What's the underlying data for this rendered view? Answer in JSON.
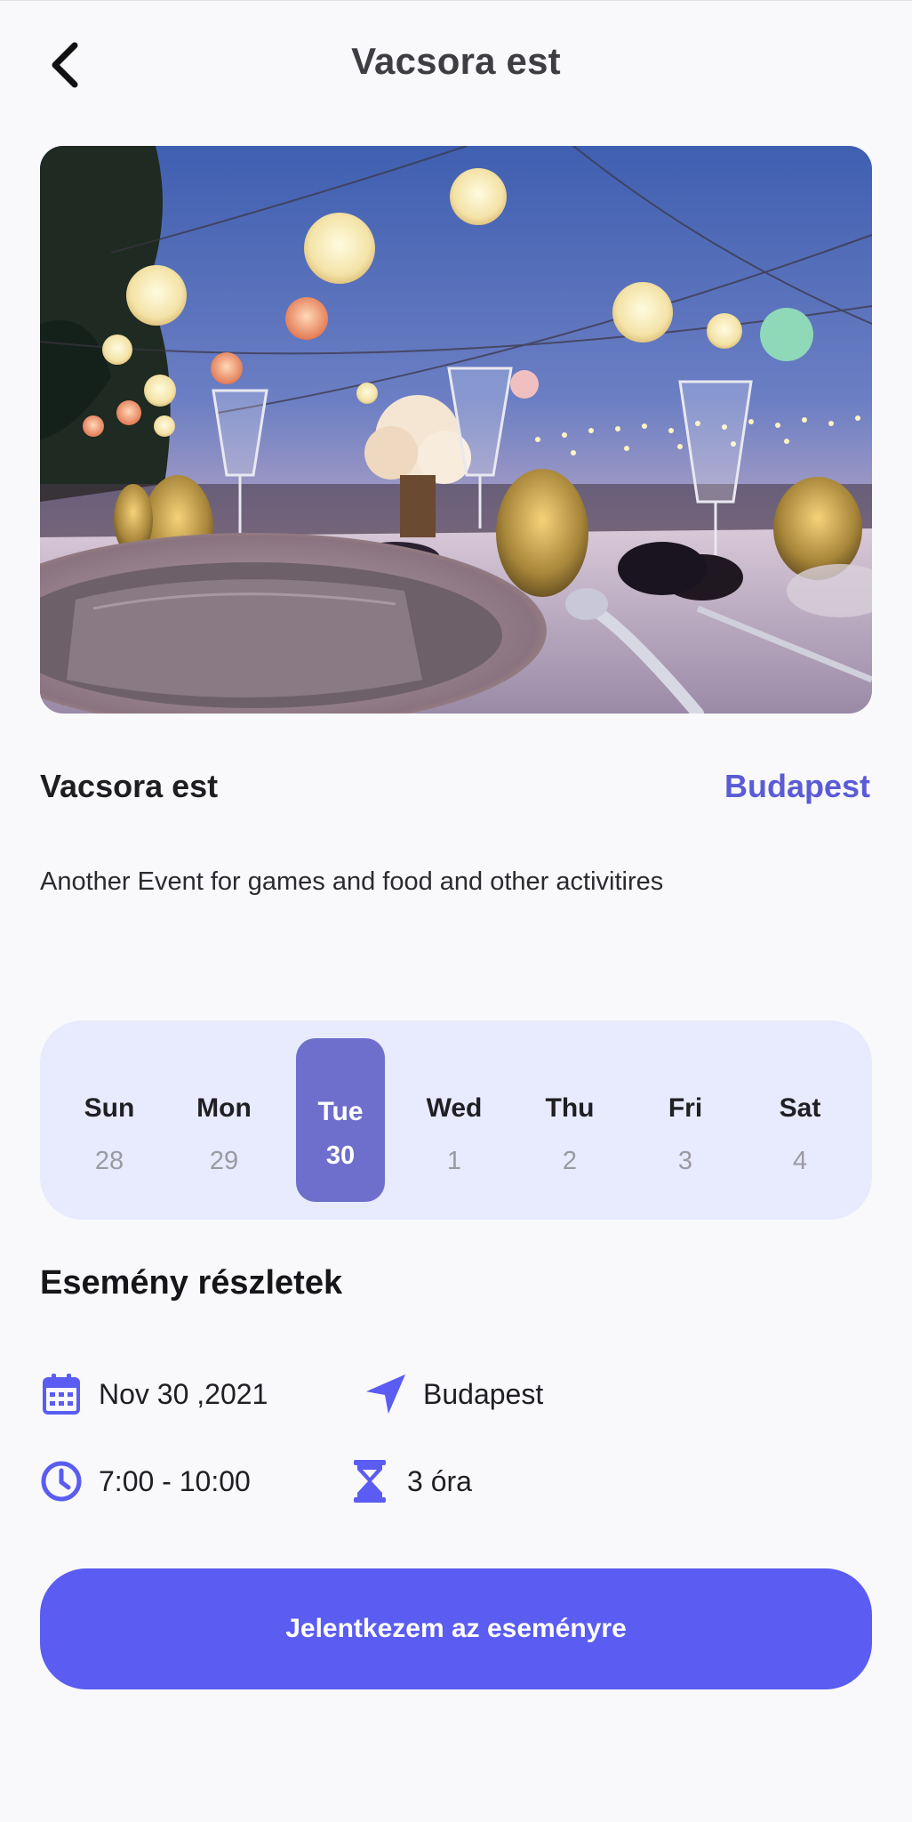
{
  "header": {
    "title": "Vacsora est",
    "back_icon": "chevron-left-icon"
  },
  "hero": {
    "image_alt_subject": "dinner-table-with-lanterns"
  },
  "event": {
    "name": "Vacsora est",
    "city": "Budapest",
    "description": "Another Event for games and food and other activitires"
  },
  "calendar": {
    "days": [
      {
        "name": "Sun",
        "num": "28"
      },
      {
        "name": "Mon",
        "num": "29"
      },
      {
        "name": "Tue",
        "num": "30"
      },
      {
        "name": "Wed",
        "num": "1"
      },
      {
        "name": "Thu",
        "num": "2"
      },
      {
        "name": "Fri",
        "num": "3"
      },
      {
        "name": "Sat",
        "num": "4"
      }
    ],
    "selected": "Tue"
  },
  "details": {
    "title": "Esemény részletek",
    "date": "Nov 30 ,2021",
    "location": "Budapest",
    "time": "7:00 - 10:00",
    "duration": "3 óra",
    "icons": [
      "calendar-icon",
      "navigation-arrow-icon",
      "clock-icon",
      "hourglass-icon"
    ]
  },
  "cta": {
    "label": "Jelentkezem az eseményre"
  },
  "colors": {
    "accent": "#5a5cf2",
    "selected_day": "#6e6fcc",
    "week_bg": "#e8eafd",
    "city": "#5b5bd6"
  }
}
